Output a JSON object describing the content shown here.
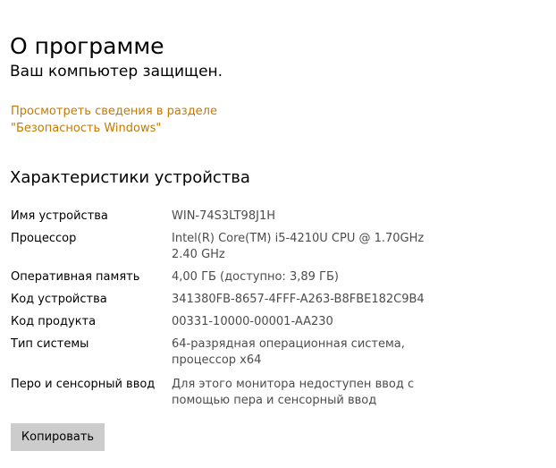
{
  "colors": {
    "link": "#c47a00",
    "value_text": "#4c4c4c",
    "button_bg": "#cccccc"
  },
  "header": {
    "title": "О программе"
  },
  "protection": {
    "status": "Ваш компьютер защищен.",
    "link": "Просмотреть сведения в разделе \"Безопасность Windows\""
  },
  "device_specs": {
    "title": "Характеристики устройства",
    "rows": [
      {
        "label": "Имя устройства",
        "value": "WIN-74S3LT98J1H"
      },
      {
        "label": "Процессор",
        "value": "Intel(R) Core(TM) i5-4210U CPU @ 1.70GHz\n2.40 GHz"
      },
      {
        "label": "Оперативная память",
        "value": "4,00 ГБ (доступно: 3,89 ГБ)"
      },
      {
        "label": "Код устройства",
        "value": "341380FB-8657-4FFF-A263-B8FBE182C9B4"
      },
      {
        "label": "Код продукта",
        "value": "00331-10000-00001-AA230"
      },
      {
        "label": "Тип системы",
        "value": "64-разрядная операционная система, процессор x64"
      },
      {
        "label": "Перо и сенсорный ввод",
        "value": "Для этого монитора недоступен ввод с помощью пера и сенсорный ввод"
      }
    ],
    "copy_button": "Копировать"
  }
}
